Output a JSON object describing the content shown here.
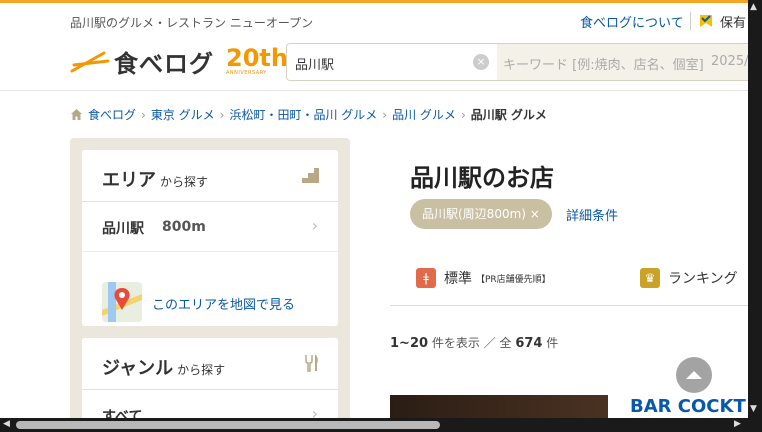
{
  "header": {
    "tagline": "品川駅のグルメ・レストラン ニューオープン",
    "about_link": "食べログについて",
    "keep_label": "保有",
    "logo_text": "食べログ",
    "anniversary_number": "20th",
    "anniversary_sub": "ANNIVERSARY",
    "accent_color": "#f39800"
  },
  "search": {
    "location_value": "品川駅",
    "keyword_placeholder": "キーワード [例:焼肉、店名、個室]",
    "date_placeholder": "2025/0"
  },
  "breadcrumb": [
    "食べログ",
    "東京 グルメ",
    "浜松町・田町・品川 グルメ",
    "品川 グルメ",
    "品川駅 グルメ"
  ],
  "sidebar": {
    "area": {
      "title": "エリア",
      "title_suffix": "から探す",
      "station": "品川駅",
      "distance": "800m",
      "map_link": "このエリアを地図で見る"
    },
    "genre": {
      "title": "ジャンル",
      "title_suffix": "から探す",
      "first_item": "すべて"
    }
  },
  "main": {
    "heading": "品川駅のお店",
    "chip_label": "品川駅(周辺800m) ×",
    "detail_link": "詳細条件",
    "tabs": [
      {
        "label": "標準",
        "note": "【PR店舗優先順】",
        "icon": "fork-knife-icon",
        "color": "#e06a4a"
      },
      {
        "label": "ランキング",
        "note": "",
        "icon": "crown-icon",
        "color": "#c9a227"
      }
    ],
    "result_range": "1~20",
    "result_text_mid": "件を表示 ／ 全",
    "result_total": "674",
    "result_unit": "件",
    "first_restaurant": "BAR COCKT"
  }
}
